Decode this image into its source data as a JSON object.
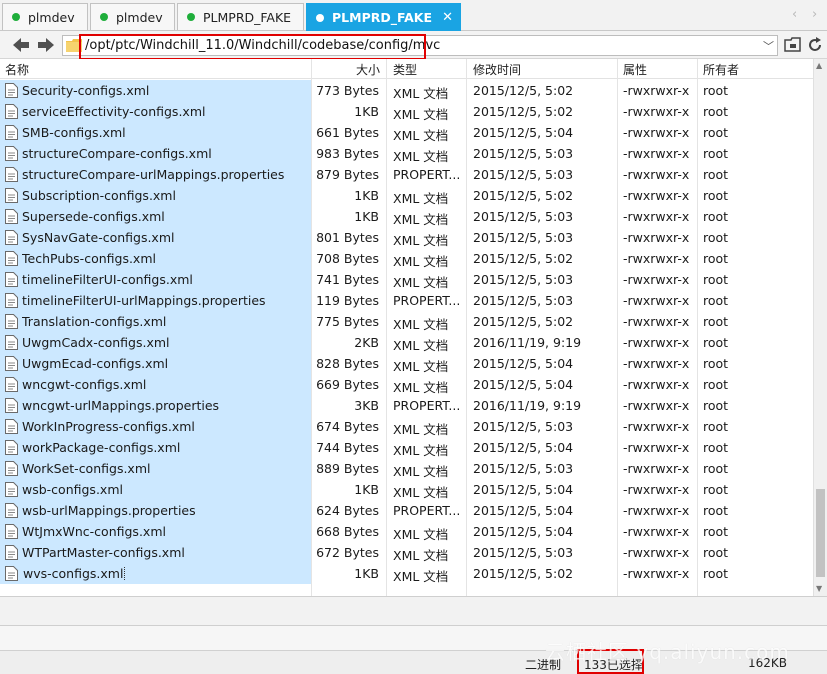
{
  "tabs": [
    {
      "label": "plmdev",
      "active": false
    },
    {
      "label": "plmdev",
      "active": false
    },
    {
      "label": "PLMPRD_FAKE",
      "active": false
    },
    {
      "label": "PLMPRD_FAKE",
      "active": true
    }
  ],
  "address": {
    "path": "/opt/ptc/Windchill_11.0/Windchill/codebase/config/mvc"
  },
  "columns": {
    "name": "名称",
    "size": "大小",
    "type": "类型",
    "modified": "修改时间",
    "permissions": "属性",
    "owner": "所有者"
  },
  "files": [
    {
      "name": "Security-configs.xml",
      "size": "773 Bytes",
      "type": "XML 文档",
      "modified": "2015/12/5, 5:02",
      "permissions": "-rwxrwxr-x",
      "owner": "root"
    },
    {
      "name": "serviceEffectivity-configs.xml",
      "size": "1KB",
      "type": "XML 文档",
      "modified": "2015/12/5, 5:02",
      "permissions": "-rwxrwxr-x",
      "owner": "root"
    },
    {
      "name": "SMB-configs.xml",
      "size": "661 Bytes",
      "type": "XML 文档",
      "modified": "2015/12/5, 5:04",
      "permissions": "-rwxrwxr-x",
      "owner": "root"
    },
    {
      "name": "structureCompare-configs.xml",
      "size": "983 Bytes",
      "type": "XML 文档",
      "modified": "2015/12/5, 5:03",
      "permissions": "-rwxrwxr-x",
      "owner": "root"
    },
    {
      "name": "structureCompare-urlMappings.properties",
      "size": "879 Bytes",
      "type": "PROPERT...",
      "modified": "2015/12/5, 5:03",
      "permissions": "-rwxrwxr-x",
      "owner": "root"
    },
    {
      "name": "Subscription-configs.xml",
      "size": "1KB",
      "type": "XML 文档",
      "modified": "2015/12/5, 5:02",
      "permissions": "-rwxrwxr-x",
      "owner": "root"
    },
    {
      "name": "Supersede-configs.xml",
      "size": "1KB",
      "type": "XML 文档",
      "modified": "2015/12/5, 5:03",
      "permissions": "-rwxrwxr-x",
      "owner": "root"
    },
    {
      "name": "SysNavGate-configs.xml",
      "size": "801 Bytes",
      "type": "XML 文档",
      "modified": "2015/12/5, 5:03",
      "permissions": "-rwxrwxr-x",
      "owner": "root"
    },
    {
      "name": "TechPubs-configs.xml",
      "size": "708 Bytes",
      "type": "XML 文档",
      "modified": "2015/12/5, 5:02",
      "permissions": "-rwxrwxr-x",
      "owner": "root"
    },
    {
      "name": "timelineFilterUI-configs.xml",
      "size": "741 Bytes",
      "type": "XML 文档",
      "modified": "2015/12/5, 5:03",
      "permissions": "-rwxrwxr-x",
      "owner": "root"
    },
    {
      "name": "timelineFilterUI-urlMappings.properties",
      "size": "119 Bytes",
      "type": "PROPERT...",
      "modified": "2015/12/5, 5:03",
      "permissions": "-rwxrwxr-x",
      "owner": "root"
    },
    {
      "name": "Translation-configs.xml",
      "size": "775 Bytes",
      "type": "XML 文档",
      "modified": "2015/12/5, 5:02",
      "permissions": "-rwxrwxr-x",
      "owner": "root"
    },
    {
      "name": "UwgmCadx-configs.xml",
      "size": "2KB",
      "type": "XML 文档",
      "modified": "2016/11/19, 9:19",
      "permissions": "-rwxrwxr-x",
      "owner": "root"
    },
    {
      "name": "UwgmEcad-configs.xml",
      "size": "828 Bytes",
      "type": "XML 文档",
      "modified": "2015/12/5, 5:04",
      "permissions": "-rwxrwxr-x",
      "owner": "root"
    },
    {
      "name": "wncgwt-configs.xml",
      "size": "669 Bytes",
      "type": "XML 文档",
      "modified": "2015/12/5, 5:04",
      "permissions": "-rwxrwxr-x",
      "owner": "root"
    },
    {
      "name": "wncgwt-urlMappings.properties",
      "size": "3KB",
      "type": "PROPERT...",
      "modified": "2016/11/19, 9:19",
      "permissions": "-rwxrwxr-x",
      "owner": "root"
    },
    {
      "name": "WorkInProgress-configs.xml",
      "size": "674 Bytes",
      "type": "XML 文档",
      "modified": "2015/12/5, 5:03",
      "permissions": "-rwxrwxr-x",
      "owner": "root"
    },
    {
      "name": "workPackage-configs.xml",
      "size": "744 Bytes",
      "type": "XML 文档",
      "modified": "2015/12/5, 5:04",
      "permissions": "-rwxrwxr-x",
      "owner": "root"
    },
    {
      "name": "WorkSet-configs.xml",
      "size": "889 Bytes",
      "type": "XML 文档",
      "modified": "2015/12/5, 5:03",
      "permissions": "-rwxrwxr-x",
      "owner": "root"
    },
    {
      "name": "wsb-configs.xml",
      "size": "1KB",
      "type": "XML 文档",
      "modified": "2015/12/5, 5:04",
      "permissions": "-rwxrwxr-x",
      "owner": "root"
    },
    {
      "name": "wsb-urlMappings.properties",
      "size": "624 Bytes",
      "type": "PROPERT...",
      "modified": "2015/12/5, 5:04",
      "permissions": "-rwxrwxr-x",
      "owner": "root"
    },
    {
      "name": "WtJmxWnc-configs.xml",
      "size": "668 Bytes",
      "type": "XML 文档",
      "modified": "2015/12/5, 5:04",
      "permissions": "-rwxrwxr-x",
      "owner": "root"
    },
    {
      "name": "WTPartMaster-configs.xml",
      "size": "672 Bytes",
      "type": "XML 文档",
      "modified": "2015/12/5, 5:03",
      "permissions": "-rwxrwxr-x",
      "owner": "root"
    },
    {
      "name": "wvs-configs.xml",
      "size": "1KB",
      "type": "XML 文档",
      "modified": "2015/12/5, 5:02",
      "permissions": "-rwxrwxr-x",
      "owner": "root"
    }
  ],
  "status": {
    "mode": "二进制",
    "selected": "133已选择",
    "total_size": "162KB"
  },
  "watermark": "云栖社区 yq.aliyun.com",
  "colors": {
    "active_tab": "#1aa4e3",
    "selection": "#cce8ff",
    "status_dot": "#1fae3b",
    "highlight_box": "#e00000"
  },
  "icons": [
    "back-arrow-icon",
    "forward-arrow-icon",
    "folder-icon",
    "chevron-down-icon",
    "open-folder-icon",
    "refresh-icon",
    "file-icon",
    "close-icon"
  ]
}
